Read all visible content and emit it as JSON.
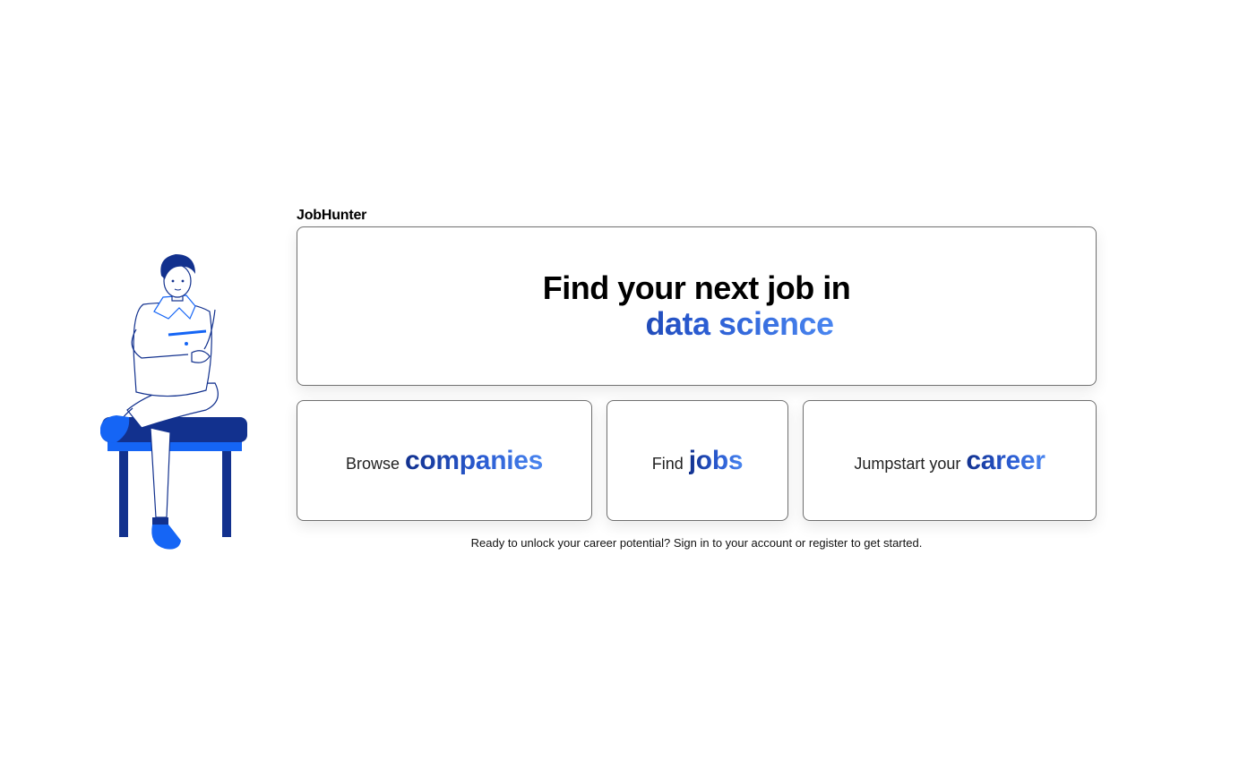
{
  "brand": {
    "name": "JobHunter"
  },
  "hero": {
    "line1": "Find your next job in",
    "line2": "data science"
  },
  "actions": [
    {
      "prefix": "Browse",
      "emphasis": "companies"
    },
    {
      "prefix": "Find",
      "emphasis": "jobs"
    },
    {
      "prefix": "Jumpstart your",
      "emphasis": "career"
    }
  ],
  "footer": {
    "note": "Ready to unlock your career potential? Sign in to your account or register to get started."
  },
  "colors": {
    "accent_dark": "#12318e",
    "accent_mid": "#2a5bd1",
    "accent_light": "#4a86f0",
    "bench": "#12318e",
    "shoe": "#1565f5"
  }
}
